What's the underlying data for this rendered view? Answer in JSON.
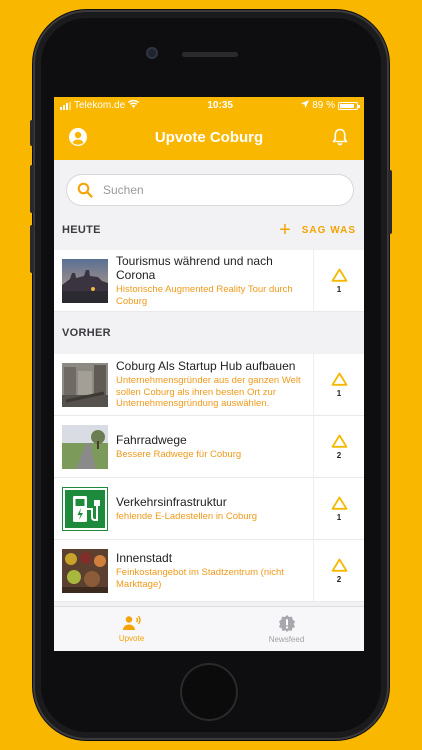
{
  "statusbar": {
    "carrier": "Telekom.de",
    "time": "10:35",
    "battery": "89 %",
    "battery_level": 0.89
  },
  "header": {
    "title": "Upvote Coburg"
  },
  "search": {
    "placeholder": "Suchen"
  },
  "sections": {
    "today": {
      "label": "HEUTE",
      "action_label": "SAG WAS"
    },
    "earlier": {
      "label": "VORHER"
    }
  },
  "today_items": [
    {
      "title": "Tourismus während und nach Corona",
      "subtitle": "Historische Augmented Reality Tour durch Coburg",
      "votes": "1"
    }
  ],
  "earlier_items": [
    {
      "title": "Coburg Als Startup Hub aufbauen",
      "subtitle": "Unternehmensgründer aus der ganzen Welt sollen Coburg als ihren besten Ort zur Unternehmensgründung auswählen.",
      "votes": "1"
    },
    {
      "title": "Fahrradwege",
      "subtitle": "Bessere Radwege für Coburg",
      "votes": "2"
    },
    {
      "title": "Verkehrsinfrastruktur",
      "subtitle": "fehlende E-Ladestellen in Coburg",
      "votes": "1"
    },
    {
      "title": "Innenstadt",
      "subtitle": "Feinkostangebot im Stadtzentrum (nicht Markttage)",
      "votes": "2"
    }
  ],
  "tabs": [
    {
      "label": "Upvote",
      "icon": "megaphone-icon",
      "active": true
    },
    {
      "label": "Newsfeed",
      "icon": "alert-badge-icon",
      "active": false
    }
  ],
  "colors": {
    "brand": "#F9B700",
    "accent": "#F5A300",
    "subtitle": "#EE9A1B"
  }
}
